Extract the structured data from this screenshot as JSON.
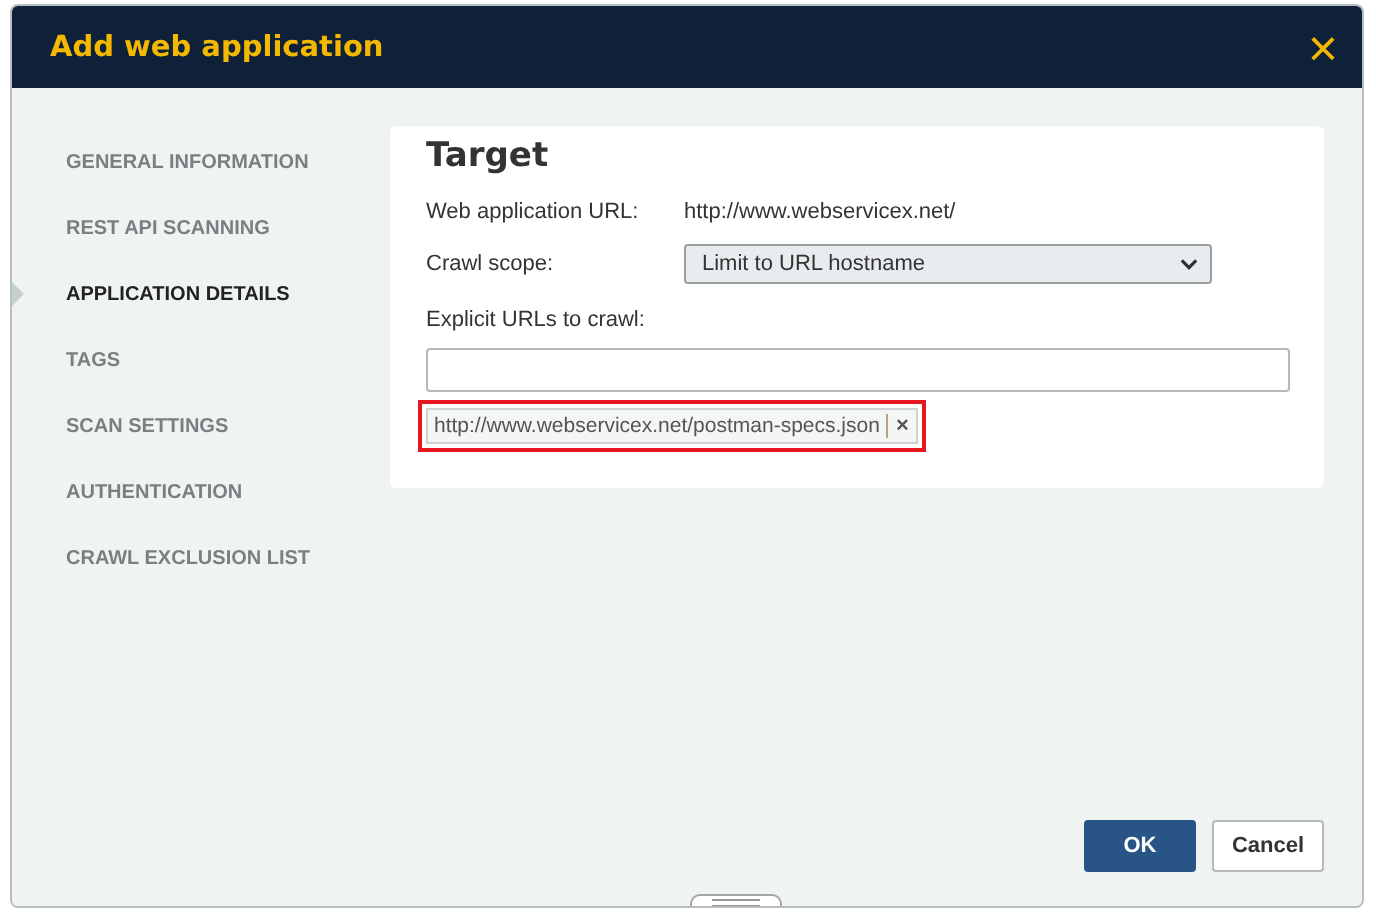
{
  "window": {
    "title": "Add web application",
    "close": "×"
  },
  "sidebar": {
    "items": [
      {
        "label": "GENERAL INFORMATION",
        "selected": false
      },
      {
        "label": "REST API SCANNING",
        "selected": false
      },
      {
        "label": "APPLICATION DETAILS",
        "selected": true
      },
      {
        "label": "TAGS",
        "selected": false
      },
      {
        "label": "SCAN SETTINGS",
        "selected": false
      },
      {
        "label": "AUTHENTICATION",
        "selected": false
      },
      {
        "label": "CRAWL EXCLUSION LIST",
        "selected": false
      }
    ]
  },
  "target": {
    "heading": "Target",
    "url_label": "Web application URL:",
    "url_value": "http://www.webservicex.net/",
    "scope_label": "Crawl scope:",
    "scope_value": "Limit to URL hostname",
    "explicit_label": "Explicit URLs to crawl:",
    "explicit_tags": [
      {
        "text": "http://www.webservicex.net/postman-specs.json",
        "remove": "×",
        "highlighted": true
      }
    ]
  },
  "buttons": [
    {
      "label": "OK",
      "kind": "primary"
    },
    {
      "label": "Cancel",
      "kind": "secondary"
    }
  ]
}
